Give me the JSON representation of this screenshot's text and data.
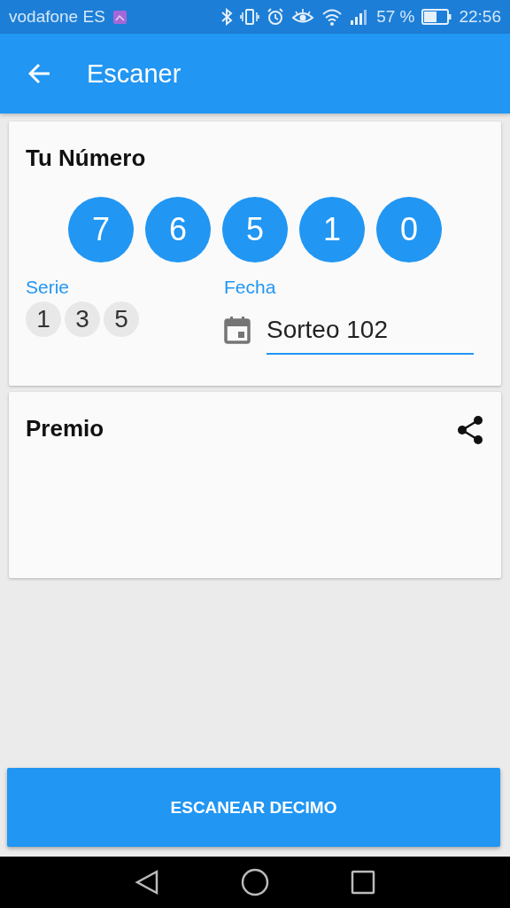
{
  "status_bar": {
    "carrier": "vodafone ES",
    "battery": "57 %",
    "time": "22:56"
  },
  "app_bar": {
    "title": "Escaner"
  },
  "number_card": {
    "title": "Tu Número",
    "digits": [
      "7",
      "6",
      "5",
      "1",
      "0"
    ],
    "serie_label": "Serie",
    "serie": [
      "1",
      "3",
      "5"
    ],
    "fecha_label": "Fecha",
    "fecha_value": "Sorteo 102"
  },
  "prize_card": {
    "title": "Premio"
  },
  "scan_button": {
    "label": "ESCANEAR DECIMO"
  }
}
